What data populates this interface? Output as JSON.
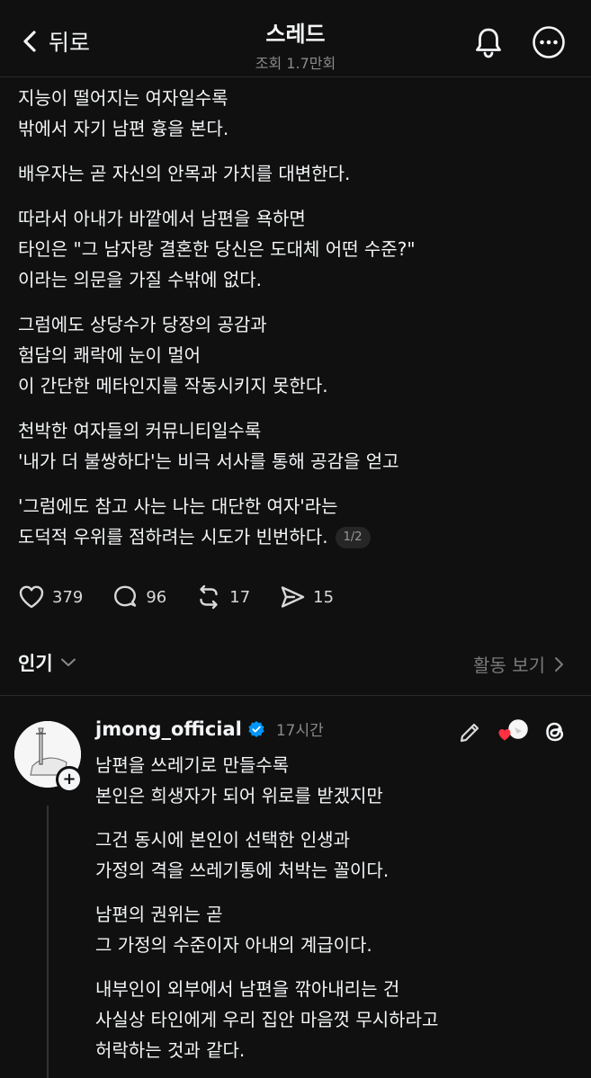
{
  "header": {
    "back_label": "뒤로",
    "title": "스레드",
    "views": "조회 1.7만회",
    "icons": [
      "chevron-left-icon",
      "bell-icon",
      "more-icon"
    ]
  },
  "post": {
    "paragraphs": [
      [
        "지능이 떨어지는 여자일수록",
        "밖에서 자기 남편 흉을 본다."
      ],
      [
        "배우자는 곧 자신의 안목과 가치를 대변한다."
      ],
      [
        "따라서 아내가 바깥에서 남편을 욕하면",
        "타인은 \"그 남자랑 결혼한 당신은 도대체 어떤 수준?\"",
        "이라는 의문을 가질 수밖에 없다."
      ],
      [
        "그럼에도 상당수가 당장의 공감과",
        "험담의 쾌락에 눈이 멀어",
        "이 간단한 메타인지를 작동시키지 못한다."
      ],
      [
        "천박한 여자들의 커뮤니티일수록",
        "'내가 더 불쌍하다'는 비극 서사를 통해 공감을 얻고"
      ],
      [
        "'그럼에도 참고 사는 나는 대단한 여자'라는",
        "도덕적 우위를 점하려는 시도가 빈번하다."
      ]
    ],
    "page_badge": "1/2"
  },
  "actions": {
    "likes": "379",
    "comments": "96",
    "reposts": "17",
    "shares": "15"
  },
  "sort": {
    "label": "인기",
    "activity_label": "활동 보기"
  },
  "reply": {
    "username": "jmong_official",
    "time": "17시간",
    "paragraphs": [
      [
        "남편을 쓰레기로 만들수록",
        "본인은 희생자가 되어 위로를 받겠지만"
      ],
      [
        "그건 동시에 본인이 선택한 인생과",
        "가정의 격을 쓰레기통에 처박는 꼴이다."
      ],
      [
        "남편의 권위는 곧",
        "그 가정의 수준이자 아내의 계급이다."
      ],
      [
        "내부인이 외부에서 남편을 깎아내리는 건",
        "사실상 타인에게 우리 집안 마음껏 무시하라고",
        "허락하는 것과 같다."
      ]
    ]
  },
  "colors": {
    "background": "#101010",
    "text": "#f3f5f7",
    "muted": "#8a8a8a",
    "verified": "#0095f6",
    "heart": "#ff3040"
  }
}
